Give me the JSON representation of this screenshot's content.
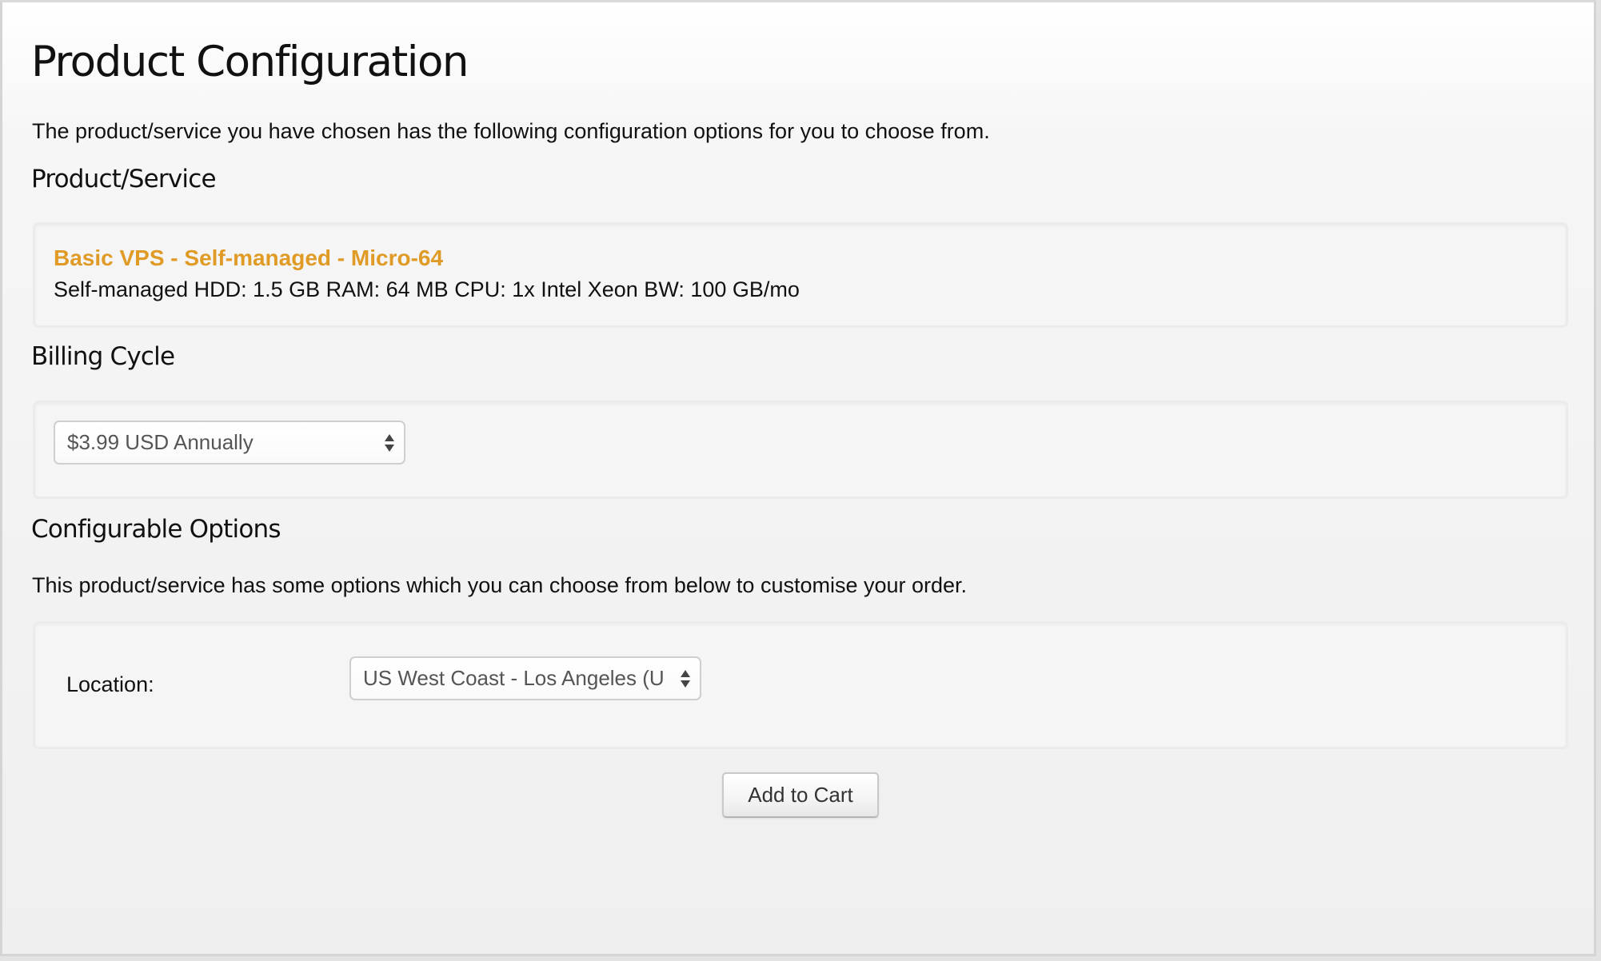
{
  "page": {
    "title": "Product Configuration",
    "intro": "The product/service you have chosen has the following configuration options for you to choose from."
  },
  "product_section": {
    "heading": "Product/Service",
    "name": "Basic VPS - Self-managed - Micro-64",
    "description": "Self-managed HDD: 1.5 GB RAM: 64 MB CPU: 1x Intel Xeon BW: 100 GB/mo",
    "name_color": "#e09b26"
  },
  "billing_section": {
    "heading": "Billing Cycle",
    "selected": "$3.99 USD Annually"
  },
  "options_section": {
    "heading": "Configurable Options",
    "description": "This product/service has some options which you can choose from below to customise your order.",
    "location_label": "Location:",
    "location_selected": "US West Coast - Los Angeles (U"
  },
  "actions": {
    "add_to_cart": "Add to Cart"
  }
}
